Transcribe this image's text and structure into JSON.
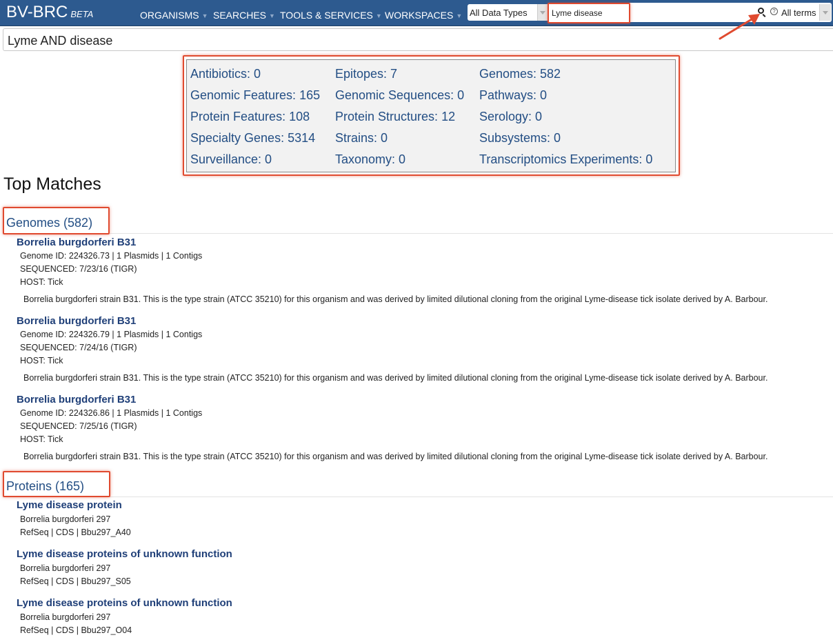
{
  "navbar": {
    "brand": "BV-BRC",
    "brand_tag": "BETA",
    "items": [
      "ORGANISMS",
      "SEARCHES",
      "TOOLS & SERVICES",
      "WORKSPACES"
    ],
    "data_type_select": "All Data Types",
    "search_value": "Lyme disease",
    "terms_select": "All terms",
    "help_glyph": "?"
  },
  "query": "Lyme AND disease",
  "summary": [
    "Antibiotics: 0",
    "Epitopes: 7",
    "Genomes: 582",
    "Genomic Features: 165",
    "Genomic Sequences: 0",
    "Pathways: 0",
    "Protein Features: 108",
    "Protein Structures: 12",
    "Serology: 0",
    "Specialty Genes: 5314",
    "Strains: 0",
    "Subsystems: 0",
    "Surveillance: 0",
    "Taxonomy: 0",
    "Transcriptomics Experiments: 0"
  ],
  "top_matches_title": "Top Matches",
  "genomes": {
    "title": "Genomes (582)",
    "results": [
      {
        "name": "Borrelia burgdorferi B31",
        "id_line": "Genome ID: 224326.73 | 1 Plasmids | 1 Contigs",
        "sequenced": "SEQUENCED: 7/23/16 (TIGR)",
        "host": "HOST: Tick",
        "desc": "Borrelia burgdorferi strain B31. This is the type strain (ATCC 35210) for this organism and was derived by limited dilutional cloning from the original Lyme-disease tick isolate derived by A. Barbour."
      },
      {
        "name": "Borrelia burgdorferi B31",
        "id_line": "Genome ID: 224326.79 | 1 Plasmids | 1 Contigs",
        "sequenced": "SEQUENCED: 7/24/16 (TIGR)",
        "host": "HOST: Tick",
        "desc": "Borrelia burgdorferi strain B31. This is the type strain (ATCC 35210) for this organism and was derived by limited dilutional cloning from the original Lyme-disease tick isolate derived by A. Barbour."
      },
      {
        "name": "Borrelia burgdorferi B31",
        "id_line": "Genome ID: 224326.86 | 1 Plasmids | 1 Contigs",
        "sequenced": "SEQUENCED: 7/25/16 (TIGR)",
        "host": "HOST: Tick",
        "desc": "Borrelia burgdorferi strain B31. This is the type strain (ATCC 35210) for this organism and was derived by limited dilutional cloning from the original Lyme-disease tick isolate derived by A. Barbour."
      }
    ]
  },
  "proteins": {
    "title": "Proteins (165)",
    "results": [
      {
        "name": "Lyme disease protein",
        "organism": "Borrelia burgdorferi 297",
        "ids": "RefSeq | CDS | Bbu297_A40"
      },
      {
        "name": "Lyme disease proteins of unknown function",
        "organism": "Borrelia burgdorferi 297",
        "ids": "RefSeq | CDS | Bbu297_S05"
      },
      {
        "name": "Lyme disease proteins of unknown function",
        "organism": "Borrelia burgdorferi 297",
        "ids": "RefSeq | CDS | Bbu297_O04"
      }
    ]
  },
  "colors": {
    "navbar": "#2d5a8f",
    "link": "#234e84",
    "annotation": "#e04a2f"
  }
}
